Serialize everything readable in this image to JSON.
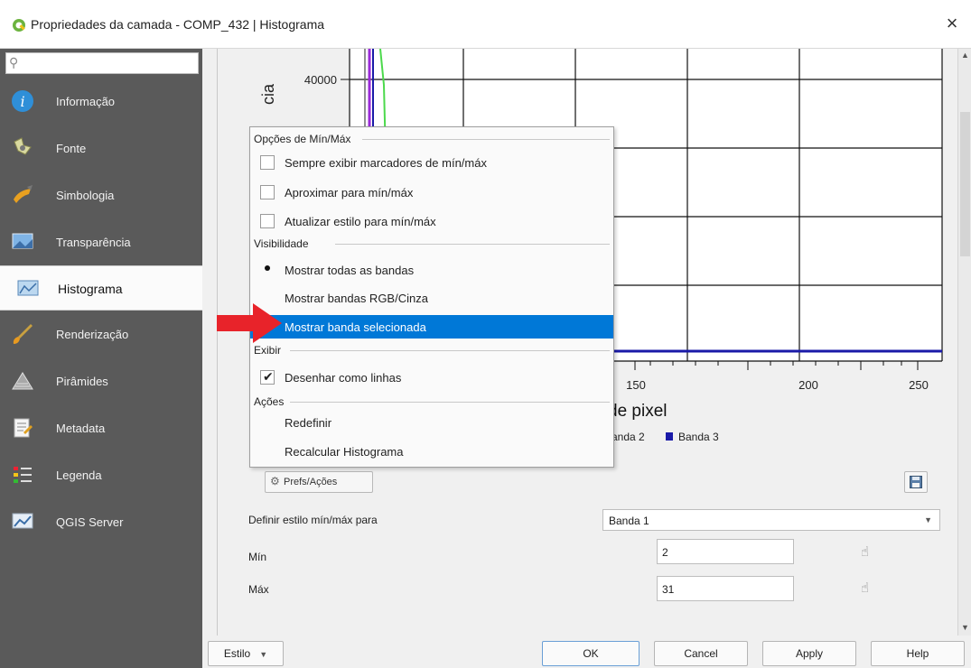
{
  "window": {
    "title": "Propriedades da camada - COMP_432 | Histograma",
    "close_glyph": "×"
  },
  "sidebar": {
    "search_placeholder": "",
    "items": [
      {
        "label": "Informação",
        "icon": "info-icon"
      },
      {
        "label": "Fonte",
        "icon": "source-icon"
      },
      {
        "label": "Simbologia",
        "icon": "symbology-icon"
      },
      {
        "label": "Transparência",
        "icon": "transparency-icon"
      },
      {
        "label": "Histograma",
        "icon": "histogram-icon",
        "active": true
      },
      {
        "label": "Renderização",
        "icon": "rendering-icon"
      },
      {
        "label": "Pirâmides",
        "icon": "pyramids-icon"
      },
      {
        "label": "Metadata",
        "icon": "metadata-icon"
      },
      {
        "label": "Legenda",
        "icon": "legend-icon"
      },
      {
        "label": "QGIS Server",
        "icon": "qgis-server-icon"
      }
    ]
  },
  "chart_data": {
    "type": "line",
    "ylabel_visible": "cia",
    "xlabel_visible": "de pixel",
    "y_tick_labels": [
      "40000"
    ],
    "x_tick_labels": [
      "150",
      "200",
      "250"
    ],
    "legend_entries_visible": [
      "Banda 2",
      "Banda 3"
    ],
    "legend_colors": {
      "Banda 2": "#4caf50",
      "Banda 3": "#1a1aa8"
    },
    "series_colors": [
      "#9a2bd8",
      "#1a1aa8",
      "#4cd94c",
      "#6b6b6b"
    ]
  },
  "menu": {
    "sections": {
      "minmax": "Opções de Mín/Máx",
      "visibility": "Visibilidade",
      "display": "Exibir",
      "actions": "Ações"
    },
    "items": {
      "always_show_markers": "Sempre exibir marcadores de mín/máx",
      "zoom_minmax": "Aproximar para mín/máx",
      "update_style": "Atualizar estilo para mín/máx",
      "show_all_bands": "Mostrar todas as bandas",
      "show_rgb_gray": "Mostrar bandas RGB/Cinza",
      "show_selected_band": "Mostrar banda selecionada",
      "draw_as_lines": "Desenhar como linhas",
      "reset": "Redefinir",
      "recompute": "Recalcular Histograma"
    }
  },
  "controls": {
    "prefs_button": "Prefs/Ações",
    "set_minmax_label": "Definir estilo mín/máx para",
    "band_value": "Banda 1",
    "min_label": "Mín",
    "min_value": "2",
    "max_label": "Máx",
    "max_value": "31"
  },
  "buttons": {
    "style": "Estilo",
    "ok": "OK",
    "cancel": "Cancel",
    "apply": "Apply",
    "help": "Help"
  }
}
